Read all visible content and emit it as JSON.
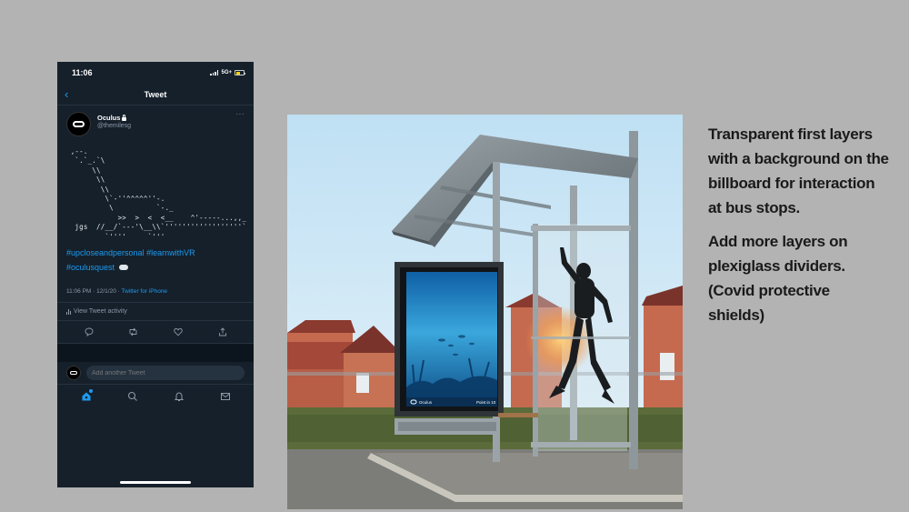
{
  "phone": {
    "status": {
      "time": "11:06",
      "network": "5G+"
    },
    "header": {
      "title": "Tweet",
      "back_icon": "back-arrow-icon"
    },
    "tweet": {
      "display_name": "Oculus",
      "handle": "@themilesg",
      "ascii_art": " ,--.\n  `.`_.`\\\n      \\\\\n       \\\\\n        \\\\\n         \\`-''^^^^^''-.\n          \\          `-._\n            >>  >  <  <__    ^'-----...,,_\n  jgs  //__/`---'\\__\\\\`''''''''''''''''''`\n         `''''     `'''",
      "hashtags": [
        "#upcloseandpersonal",
        "#learnwithVR",
        "#oculusquest"
      ],
      "timestamp": "11:06 PM · 12/1/20 · ",
      "client": "Twitter for iPhone",
      "activity": "View Tweet activity"
    },
    "reply": {
      "placeholder": "Add another Tweet"
    },
    "colors": {
      "background": "#15202b",
      "accent": "#1d9bf0"
    }
  },
  "billboard": {
    "brand": "Oculus",
    "tagline": "Point in 10"
  },
  "notes": {
    "paragraph_1": "Transparent first layers with a background on the billboard for interaction at bus stops.",
    "paragraph_2": "Add more layers on plexiglass dividers. (Covid protective shields)"
  }
}
